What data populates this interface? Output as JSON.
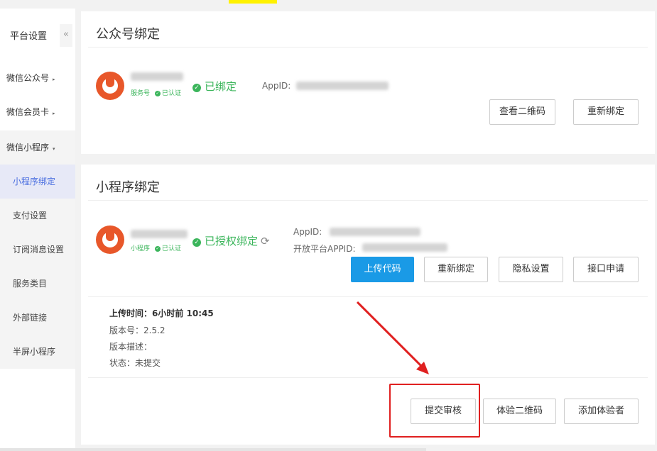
{
  "sidebar": {
    "title": "平台设置",
    "collapse_glyph": "«",
    "items": [
      {
        "label": "微信公众号",
        "caret": "▸"
      },
      {
        "label": "微信会员卡",
        "caret": "▸"
      },
      {
        "label": "微信小程序",
        "caret": "▾"
      }
    ],
    "subitems": [
      {
        "label": "小程序绑定",
        "active": true
      },
      {
        "label": "支付设置"
      },
      {
        "label": "订阅消息设置"
      },
      {
        "label": "服务类目"
      },
      {
        "label": "外部链接"
      },
      {
        "label": "半屏小程序"
      }
    ]
  },
  "official_account": {
    "title": "公众号绑定",
    "type_tag": "服务号",
    "verified_tag": "已认证",
    "status": "已绑定",
    "appid_label": "AppID:",
    "buttons": {
      "view_qr": "查看二维码",
      "rebind": "重新绑定"
    }
  },
  "mini_program": {
    "title": "小程序绑定",
    "type_tag": "小程序",
    "verified_tag": "已认证",
    "status": "已授权绑定",
    "refresh_glyph": "⟳",
    "appid_label": "AppID:",
    "open_appid_label": "开放平台APPID:",
    "buttons": {
      "upload_code": "上传代码",
      "rebind": "重新绑定",
      "privacy": "隐私设置",
      "api_apply": "接口申请"
    },
    "info": {
      "upload_time": "上传时间：6小时前 10:45",
      "version": "版本号：2.5.2",
      "description": "版本描述：",
      "status": "状态：未提交"
    },
    "bottom_buttons": {
      "submit_review": "提交审核",
      "trial_qr": "体验二维码",
      "add_tester": "添加体验者"
    }
  },
  "colors": {
    "green": "#3bb55b",
    "primary": "#1a9ae6",
    "annotation": "#e02020",
    "active": "#4a6ee0"
  }
}
